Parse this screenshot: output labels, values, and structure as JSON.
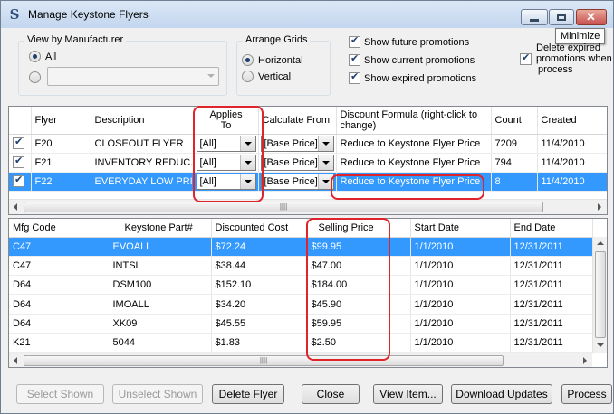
{
  "window": {
    "title": "Manage Keystone Flyers",
    "tooltip": "Minimize"
  },
  "options": {
    "view_by_manufacturer": {
      "label": "View by Manufacturer",
      "all_label": "All",
      "all_selected": true,
      "combo_value": ""
    },
    "arrange_grids": {
      "label": "Arrange Grids",
      "horizontal_label": "Horizontal",
      "vertical_label": "Vertical",
      "selected": "Horizontal"
    },
    "checkboxes": {
      "future": "Show future promotions",
      "current": "Show current promotions",
      "expired": "Show expired promotions",
      "delete_expired_1": "Delete  expired",
      "delete_expired_2": "promotions  when",
      "delete_expired_3": "process"
    }
  },
  "flyer_grid": {
    "columns": {
      "flyer": "Flyer",
      "description": "Description",
      "applies_to": "Applies To",
      "calculate_from": "Calculate From",
      "discount_formula": "Discount Formula (right-click to change)",
      "count": "Count",
      "created": "Created"
    },
    "rows": [
      {
        "checked": true,
        "flyer": "F20",
        "description": "CLOSEOUT FLYER",
        "applies_to": "[All]",
        "calculate_from": "[Base Price]",
        "discount_formula": "Reduce to Keystone Flyer Price",
        "count": "7209",
        "created": "11/4/2010",
        "selected": false
      },
      {
        "checked": true,
        "flyer": "F21",
        "description": "INVENTORY REDUC...",
        "applies_to": "[All]",
        "calculate_from": "[Base Price]",
        "discount_formula": "Reduce to Keystone Flyer Price",
        "count": "794",
        "created": "11/4/2010",
        "selected": false
      },
      {
        "checked": true,
        "flyer": "F22",
        "description": "EVERYDAY LOW PRI...",
        "applies_to": "[All]",
        "calculate_from": "[Base Price]",
        "discount_formula": "Reduce to Keystone Flyer Price",
        "count": "8",
        "created": "11/4/2010",
        "selected": true
      }
    ]
  },
  "parts_grid": {
    "columns": {
      "mfg_code": "Mfg Code",
      "keystone_part": "Keystone Part#",
      "discounted_cost": "Discounted Cost",
      "selling_price": "Selling Price",
      "start_date": "Start Date",
      "end_date": "End Date"
    },
    "rows": [
      {
        "mfg_code": "C47",
        "keystone_part": "EVOALL",
        "discounted_cost": "$72.24",
        "selling_price": "$99.95",
        "start_date": "1/1/2010",
        "end_date": "12/31/2011",
        "selected": true
      },
      {
        "mfg_code": "C47",
        "keystone_part": "INTSL",
        "discounted_cost": "$38.44",
        "selling_price": "$47.00",
        "start_date": "1/1/2010",
        "end_date": "12/31/2011",
        "selected": false
      },
      {
        "mfg_code": "D64",
        "keystone_part": "DSM100",
        "discounted_cost": "$152.10",
        "selling_price": "$184.00",
        "start_date": "1/1/2010",
        "end_date": "12/31/2011",
        "selected": false
      },
      {
        "mfg_code": "D64",
        "keystone_part": "IMOALL",
        "discounted_cost": "$34.20",
        "selling_price": "$45.90",
        "start_date": "1/1/2010",
        "end_date": "12/31/2011",
        "selected": false
      },
      {
        "mfg_code": "D64",
        "keystone_part": "XK09",
        "discounted_cost": "$45.55",
        "selling_price": "$59.95",
        "start_date": "1/1/2010",
        "end_date": "12/31/2011",
        "selected": false
      },
      {
        "mfg_code": "K21",
        "keystone_part": "5044",
        "discounted_cost": "$1.83",
        "selling_price": "$2.50",
        "start_date": "1/1/2010",
        "end_date": "12/31/2011",
        "selected": false
      }
    ]
  },
  "buttons": {
    "select_shown": "Select Shown",
    "unselect_shown": "Unselect Shown",
    "delete_flyer": "Delete Flyer",
    "close": "Close",
    "view_item": "View Item...",
    "download_updates": "Download Updates",
    "process": "Process"
  },
  "colors": {
    "selection": "#3399ff",
    "highlight_marker": "#e0242b",
    "titlebar": "#c3d6ee"
  },
  "icons": {
    "app": "keystone-logo-icon",
    "minimize": "minimize-icon",
    "maximize": "maximize-icon",
    "close": "close-icon"
  }
}
